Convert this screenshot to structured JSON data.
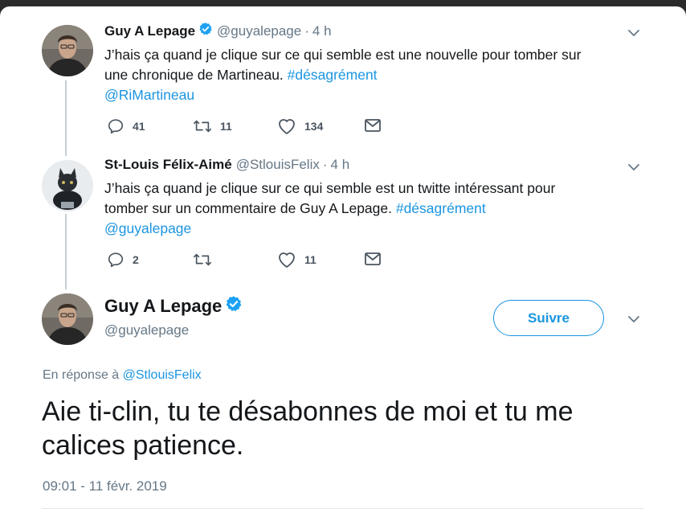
{
  "colors": {
    "link": "#1b95e0",
    "verified": "#1da1f2",
    "secondary_text": "#657786",
    "thread_line": "#c4cfd6"
  },
  "tweet1": {
    "name": "Guy A Lepage",
    "handle": "@guyalepage",
    "separator": "·",
    "time": "4 h",
    "line1": "J’hais ça quand je clique sur ce qui semble est une nouvelle pour tomber sur",
    "line2_text": "une chronique de Martineau. ",
    "hashtag": "#désagrément",
    "mention": "@RiMartineau",
    "replies": "41",
    "retweets": "11",
    "likes": "134"
  },
  "tweet2": {
    "name": "St-Louis Félix-Aimé",
    "handle": "@StlouisFelix",
    "separator": "·",
    "time": "4 h",
    "line1": "J’hais ça quand je clique sur ce qui semble est un twitte intéressant pour",
    "line2_text": "tomber sur un commentaire de Guy A Lepage. ",
    "hashtag": "#désagrément",
    "mention": "@guyalepage",
    "replies": "2",
    "likes": "11"
  },
  "main_tweet": {
    "name": "Guy A Lepage",
    "handle": "@guyalepage",
    "follow_label": "Suivre",
    "reply_prefix": "En réponse à ",
    "reply_to": "@StlouisFelix",
    "text": "Aie ti-clin, tu te désabonnes de moi et tu me calices patience.",
    "timestamp": "09:01 - 11 févr. 2019"
  },
  "icons": {
    "verified": "verified-badge-icon",
    "chevron": "chevron-down-icon",
    "reply": "reply-icon",
    "retweet": "retweet-icon",
    "like": "heart-icon",
    "dm": "envelope-icon"
  }
}
